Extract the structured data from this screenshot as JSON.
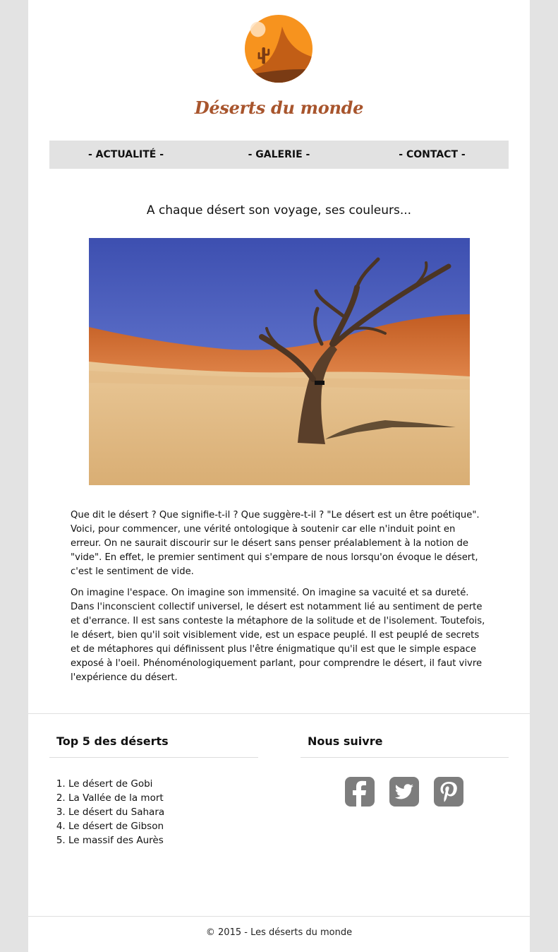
{
  "header": {
    "logo_icon": "desert-sun-cactus-icon",
    "title": "Déserts du monde",
    "title_color": "#a8552d"
  },
  "nav": {
    "items": [
      {
        "label": "- ACTUALITÉ -"
      },
      {
        "label": "- GALERIE -"
      },
      {
        "label": "- CONTACT -"
      }
    ]
  },
  "main": {
    "headline": "A chaque désert son voyage, ses couleurs...",
    "hero_image": "dead-tree-in-desert-image",
    "paragraphs": [
      "Que dit le désert ? Que signifie-t-il ? Que suggère-t-il ? \"Le désert est un être poétique\". Voici, pour commencer, une vérité ontologique à soutenir car elle n'induit point en erreur. On ne saurait discourir sur le désert sans penser préalablement à la notion de \"vide\". En effet, le premier sentiment qui s'empare de nous lorsqu'on évoque le désert, c'est le sentiment de vide.",
      "On imagine l'espace. On imagine son immensité. On imagine sa vacuité et sa dureté. Dans l'inconscient collectif universel, le désert est notamment lié au sentiment de perte et d'errance. Il est sans conteste la métaphore de la solitude et de l'isolement. Toutefois, le désert, bien qu'il soit visiblement vide, est un espace peuplé. Il est peuplé de secrets et de métaphores qui définissent plus l'être énigmatique qu'il est que le simple espace exposé à l'oeil. Phénoménologiquement parlant, pour comprendre le désert, il faut vivre l'expérience du désert."
    ]
  },
  "top5": {
    "title": "Top 5 des déserts",
    "items": [
      "Le désert de Gobi",
      "La Vallée de la mort",
      "Le désert du Sahara",
      "Le désert de Gibson",
      "Le massif des Aurès"
    ]
  },
  "follow": {
    "title": "Nous suivre",
    "icons": [
      "facebook-icon",
      "twitter-icon",
      "pinterest-icon"
    ],
    "icon_color": "#7d7d7d"
  },
  "footer": {
    "text": "© 2015 - Les déserts du monde"
  }
}
